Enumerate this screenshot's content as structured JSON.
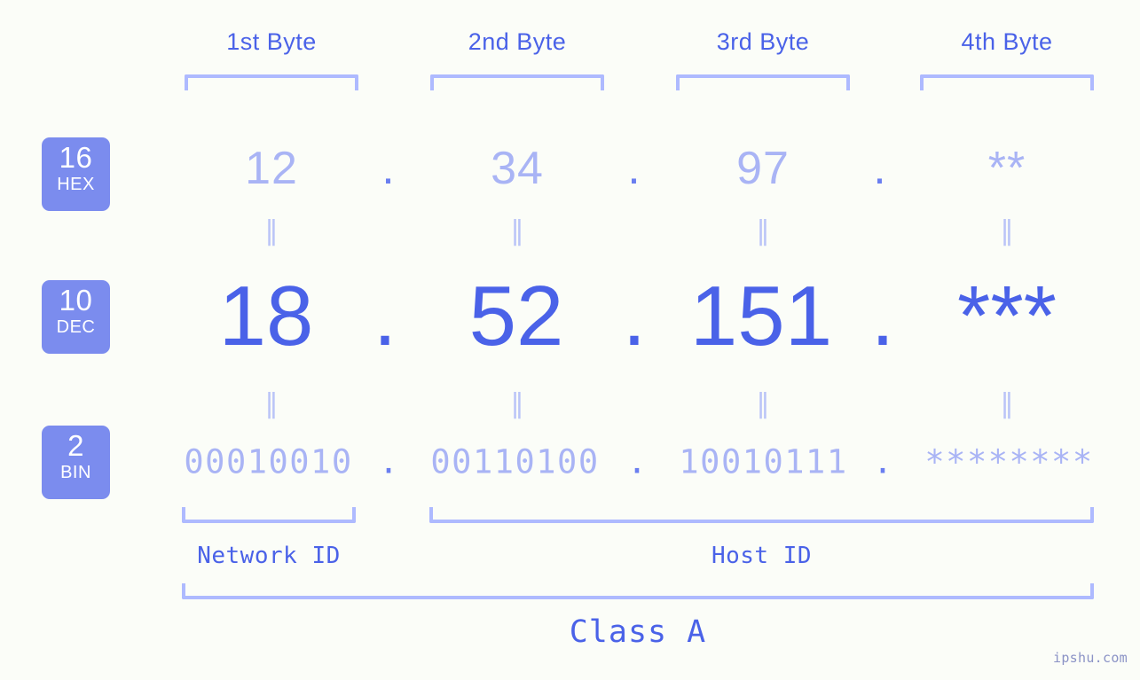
{
  "page": {
    "background": "#fbfdf8",
    "accent_strong": "#4a62e8",
    "accent_light": "#a9b4f5",
    "bracket_color": "#aebaff",
    "badge_bg": "#7b8cee",
    "watermark": "ipshu.com"
  },
  "byte_headers": [
    {
      "label": "1st Byte"
    },
    {
      "label": "2nd Byte"
    },
    {
      "label": "3rd Byte"
    },
    {
      "label": "4th Byte"
    }
  ],
  "bases": [
    {
      "number": "16",
      "name": "HEX"
    },
    {
      "number": "10",
      "name": "DEC"
    },
    {
      "number": "2",
      "name": "BIN"
    }
  ],
  "separator": ".",
  "equals_mark": "‖",
  "rows": {
    "hex": {
      "base": "16",
      "base_name": "HEX",
      "values": [
        "12",
        "34",
        "97",
        "**"
      ]
    },
    "dec": {
      "base": "10",
      "base_name": "DEC",
      "values": [
        "18",
        "52",
        "151",
        "***"
      ]
    },
    "bin": {
      "base": "2",
      "base_name": "BIN",
      "values": [
        "00010010",
        "00110100",
        "10010111",
        "********"
      ]
    }
  },
  "segments": {
    "network_id": "Network ID",
    "host_id": "Host ID",
    "class": "Class A"
  }
}
